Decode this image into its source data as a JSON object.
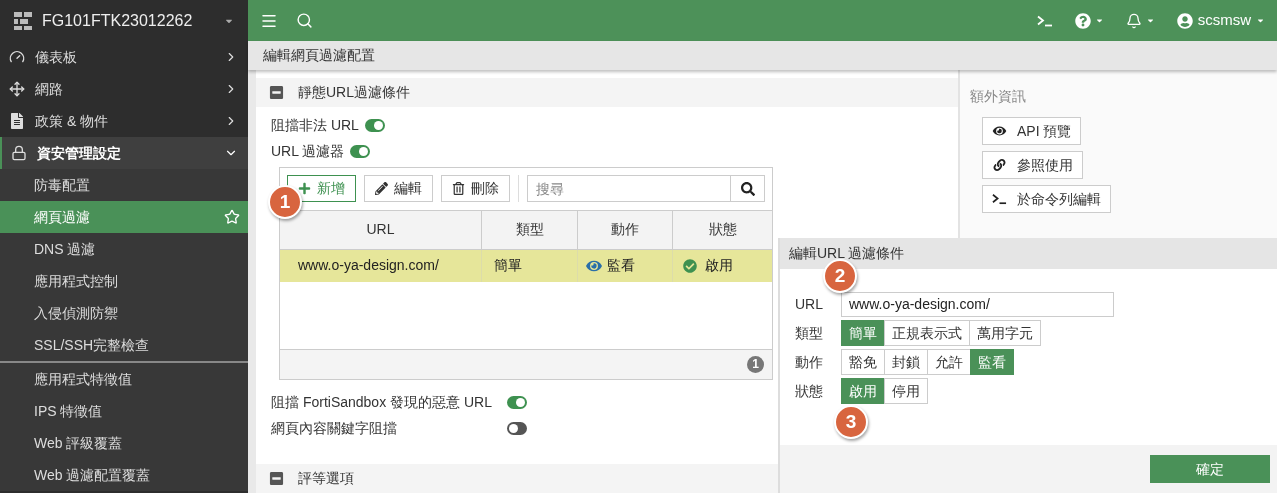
{
  "sidebar": {
    "device": {
      "name": "FG101FTK23012262"
    },
    "items": [
      {
        "label": "儀表板",
        "expanded": false
      },
      {
        "label": "網路",
        "expanded": false
      },
      {
        "label": "政策 & 物件",
        "expanded": false
      },
      {
        "label": "資安管理設定",
        "expanded": true,
        "groups": [
          {
            "children": [
              {
                "label": "防毒配置",
                "selected": false
              },
              {
                "label": "網頁過濾",
                "selected": true
              },
              {
                "label": "DNS 過濾",
                "selected": false
              },
              {
                "label": "應用程式控制",
                "selected": false
              },
              {
                "label": "入侵偵測防禦",
                "selected": false
              },
              {
                "label": "SSL/SSH完整檢查",
                "selected": false
              }
            ]
          },
          {
            "children": [
              {
                "label": "應用程式特徵值",
                "selected": false
              },
              {
                "label": "IPS 特徵值",
                "selected": false
              },
              {
                "label": "Web 評級覆蓋",
                "selected": false
              },
              {
                "label": "Web 過濾配置覆蓋",
                "selected": false
              }
            ]
          }
        ]
      }
    ]
  },
  "topbar": {
    "user": "scsmsw"
  },
  "page_title": "編輯網頁過濾配置",
  "static_url_section": {
    "title": "靜態URL過濾條件",
    "expanded": true,
    "toggles_top": [
      {
        "label": "阻擋非法 URL",
        "on": true
      },
      {
        "label": "URL 過濾器",
        "on": true
      }
    ],
    "toolbar": {
      "buttons": [
        {
          "label": "新增",
          "kind": "primary"
        },
        {
          "label": "編輯",
          "kind": "default"
        },
        {
          "label": "刪除",
          "kind": "default"
        }
      ],
      "search_placeholder": "搜尋"
    },
    "table": {
      "columns": [
        "URL",
        "類型",
        "動作",
        "狀態"
      ],
      "rows": [
        {
          "url": "www.o-ya-design.com/",
          "type": "簡單",
          "action": "監看",
          "status": "啟用",
          "selected": true
        }
      ],
      "footer_count": "1"
    },
    "toggles_bottom": [
      {
        "label": "阻擋 FortiSandbox 發現的惡意 URL",
        "on": true
      },
      {
        "label": "網頁內容關鍵字阻擋",
        "on": false
      }
    ]
  },
  "rating_section": {
    "title": "評等選項",
    "expanded": true
  },
  "info_panel": {
    "title": "額外資訊",
    "buttons": [
      "API 預覽",
      "參照使用",
      "於命令列編輯"
    ]
  },
  "dialog": {
    "title": "編輯URL 過濾條件",
    "fields": [
      {
        "kind": "text",
        "label": "URL",
        "value": "www.o-ya-design.com/"
      },
      {
        "kind": "segmented",
        "label": "類型",
        "options": [
          {
            "label": "簡單",
            "selected": true
          },
          {
            "label": "正規表示式",
            "selected": false
          },
          {
            "label": "萬用字元",
            "selected": false
          }
        ]
      },
      {
        "kind": "segmented",
        "label": "動作",
        "options": [
          {
            "label": "豁免",
            "selected": false
          },
          {
            "label": "封鎖",
            "selected": false
          },
          {
            "label": "允許",
            "selected": false
          },
          {
            "label": "監看",
            "selected": true
          }
        ]
      },
      {
        "kind": "segmented",
        "label": "狀態",
        "options": [
          {
            "label": "啟用",
            "selected": true
          },
          {
            "label": "停用",
            "selected": false
          }
        ]
      }
    ],
    "ok_button": "確定"
  },
  "annotations": [
    "1",
    "2",
    "3"
  ]
}
